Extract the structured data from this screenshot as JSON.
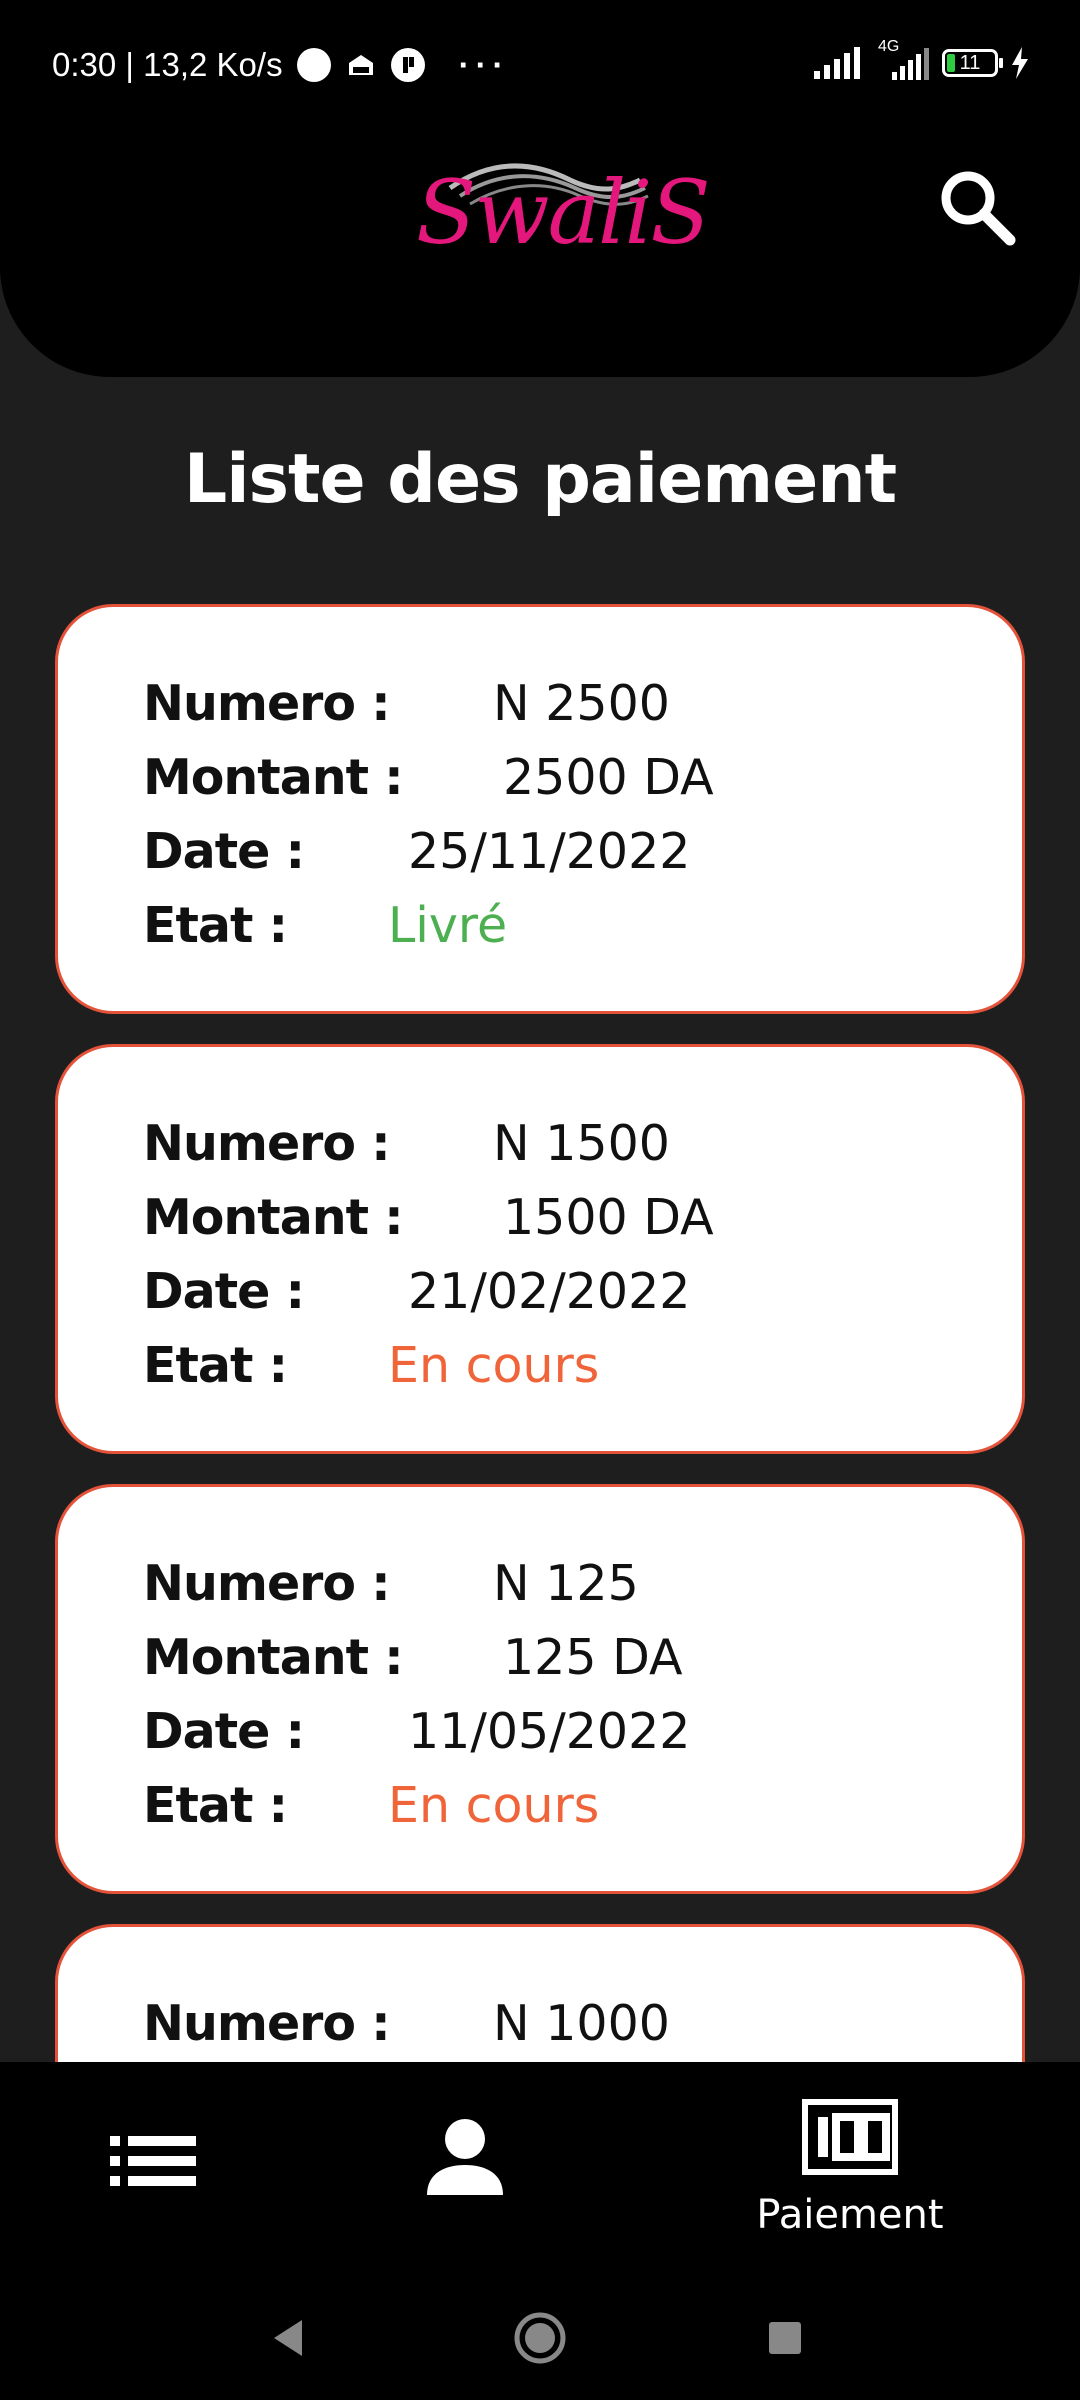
{
  "status_bar": {
    "time_speed": "0:30 | 13,2 Ko/s",
    "network_label": "4G",
    "battery_level": "11"
  },
  "header": {
    "logo_text": "SwaliS",
    "brand_color": "#e3177c"
  },
  "page": {
    "title": "Liste des paiement"
  },
  "labels": {
    "numero": "Numero :",
    "montant": "Montant :",
    "date": "Date :",
    "etat": "Etat :"
  },
  "payments": [
    {
      "numero": "N 2500",
      "montant": "2500 DA",
      "date": "25/11/2022",
      "etat": "Livré",
      "etat_color": "#4caf50"
    },
    {
      "numero": "N 1500",
      "montant": "1500 DA",
      "date": "21/02/2022",
      "etat": "En cours",
      "etat_color": "#f0643a"
    },
    {
      "numero": "N 125",
      "montant": "125 DA",
      "date": "11/05/2022",
      "etat": "En cours",
      "etat_color": "#f0643a"
    },
    {
      "numero": "N 1000"
    }
  ],
  "bottom_nav": {
    "items": [
      {
        "icon": "list-icon"
      },
      {
        "icon": "person-icon"
      },
      {
        "icon": "payment-100-icon",
        "label": "Paiement"
      }
    ]
  },
  "system_nav": {
    "back": "back-icon",
    "home": "home-icon",
    "recents": "recents-icon"
  }
}
